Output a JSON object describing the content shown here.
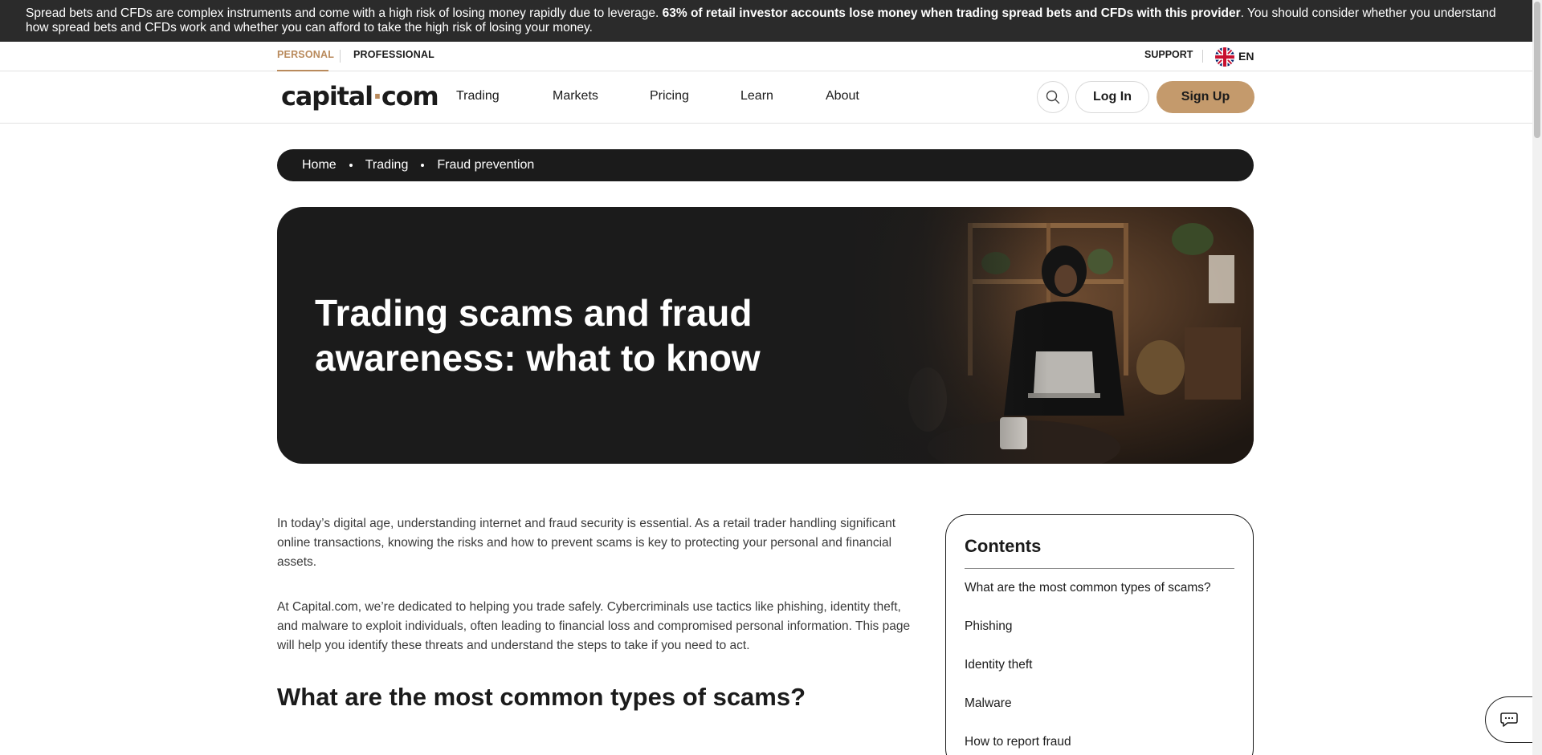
{
  "risk_banner": {
    "text_before": "Spread bets and CFDs are complex instruments and come with a high risk of losing money rapidly due to leverage. ",
    "text_bold": "63% of retail investor accounts lose money when trading spread bets and CFDs with this provider",
    "text_after": ". You should consider whether you understand how spread bets and CFDs work and whether you can afford to take the high risk of losing your money."
  },
  "top_strip": {
    "personal": "PERSONAL",
    "professional": "PROFESSIONAL",
    "support": "SUPPORT",
    "language": "EN"
  },
  "header": {
    "logo_left": "capital",
    "logo_dot": "·",
    "logo_right": "com",
    "nav": [
      "Trading",
      "Markets",
      "Pricing",
      "Learn",
      "About"
    ],
    "login": "Log In",
    "signup": "Sign Up",
    "icons": {
      "search": "search-icon",
      "flag": "uk-flag-icon"
    }
  },
  "breadcrumb": [
    "Home",
    "Trading",
    "Fraud prevention"
  ],
  "hero": {
    "title": "Trading scams and fraud awareness: what to know"
  },
  "article": {
    "paragraphs": [
      "In today’s digital age, understanding internet and fraud security is essential. As a retail trader handling significant online transactions, knowing the risks and how to prevent scams is key to protecting your personal and financial assets.",
      "At Capital.com, we’re dedicated to helping you trade safely. Cybercriminals use tactics like phishing, identity theft, and malware to exploit individuals, often leading to financial loss and compromised personal information. This page will help you identify these threats and understand the steps to take if you need to act."
    ],
    "heading": "What are the most common types of scams?"
  },
  "contents": {
    "title": "Contents",
    "items": [
      "What are the most common types of scams?",
      "Phishing",
      "Identity theft",
      "Malware",
      "How to report fraud"
    ]
  },
  "colors": {
    "accent": "#c49a6c",
    "accent_text": "#b98a5c",
    "dark": "#1b1b1b",
    "banner": "#2b2b2b"
  },
  "chat": {
    "icon": "chat-icon"
  }
}
